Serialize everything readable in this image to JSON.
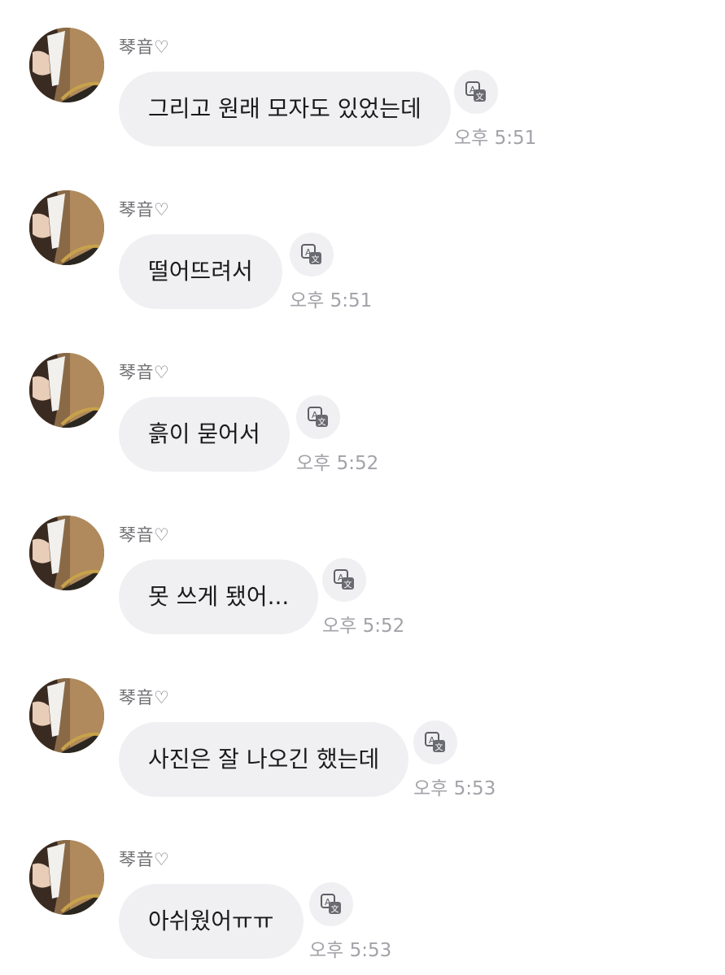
{
  "messages": [
    {
      "sender": "琴音♡",
      "text": "그리고 원래 모자도 있었는데",
      "time": "오후 5:51"
    },
    {
      "sender": "琴音♡",
      "text": "떨어뜨려서",
      "time": "오후 5:51"
    },
    {
      "sender": "琴音♡",
      "text": "흙이 묻어서",
      "time": "오후 5:52"
    },
    {
      "sender": "琴音♡",
      "text": "못 쓰게 됐어...",
      "time": "오후 5:52"
    },
    {
      "sender": "琴音♡",
      "text": "사진은 잘 나오긴 했는데",
      "time": "오후 5:53"
    },
    {
      "sender": "琴音♡",
      "text": "아쉬웠어ㅠㅠ",
      "time": "오후 5:53"
    }
  ],
  "translate_icon": "translate-icon",
  "colors": {
    "bubble": "#f0f0f3",
    "timestamp": "#a2a2a8",
    "sender": "#707074"
  }
}
